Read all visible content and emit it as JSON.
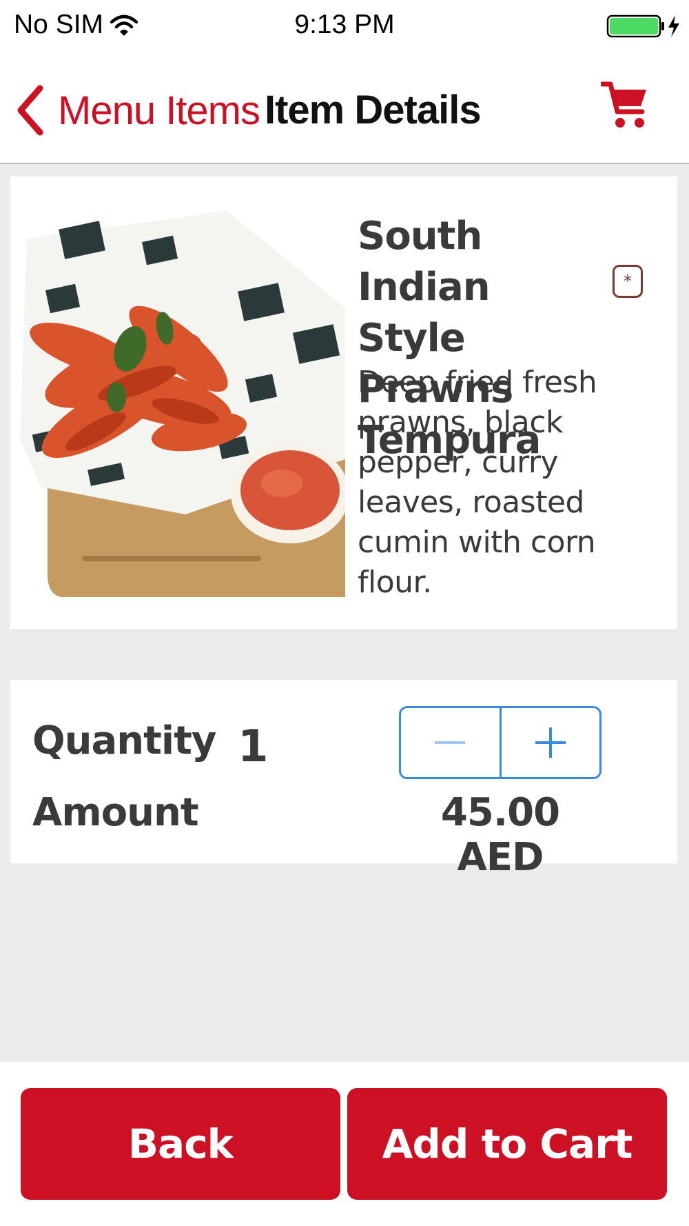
{
  "status_bar": {
    "carrier": "No SIM",
    "time": "9:13 PM",
    "battery_color": "#4cd964"
  },
  "nav": {
    "back_label": "Menu Items",
    "title": "Item Details",
    "accent_color": "#cc1124",
    "cart_icon": "shopping-cart-icon"
  },
  "item": {
    "name": "South Indian Style Prawns Tempura",
    "badge": "*",
    "description": "Deep fried fresh prawns, black pepper, curry leaves, roasted cumin with corn flour."
  },
  "order": {
    "quantity_label": "Quantity",
    "quantity": "1",
    "amount_label": "Amount",
    "amount": "45.00 AED",
    "stepper_color": "#3a8bde"
  },
  "actions": {
    "back_label": "Back",
    "add_to_cart_label": "Add to Cart"
  }
}
